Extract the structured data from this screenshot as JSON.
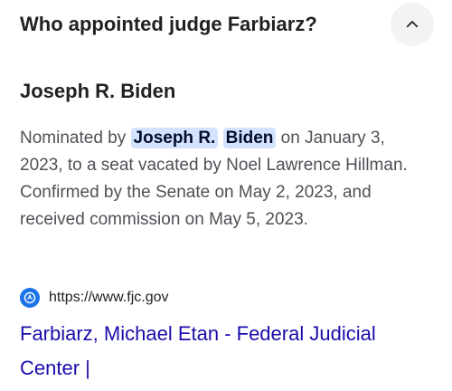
{
  "question": "Who appointed judge Farbiarz?",
  "answer": {
    "title": "Joseph R. Biden",
    "snippet": {
      "prefix": "Nominated by ",
      "highlight_1": "Joseph R.",
      "highlight_2": "Biden",
      "suffix": " on January 3, 2023, to a seat vacated by Noel Lawrence Hillman. Confirmed by the Senate on May 2, 2023, and received commission on May 5, 2023."
    }
  },
  "source": {
    "url": "https://www.fjc.gov",
    "title": "Farbiarz, Michael Etan - Federal Judicial Center |",
    "favicon": "fjc-seal-icon"
  },
  "icons": {
    "collapse": "chevron-up-icon"
  },
  "colors": {
    "highlight_bg": "#d3e3fd",
    "link": "#1a0dab",
    "favicon": "#1a73e8"
  }
}
